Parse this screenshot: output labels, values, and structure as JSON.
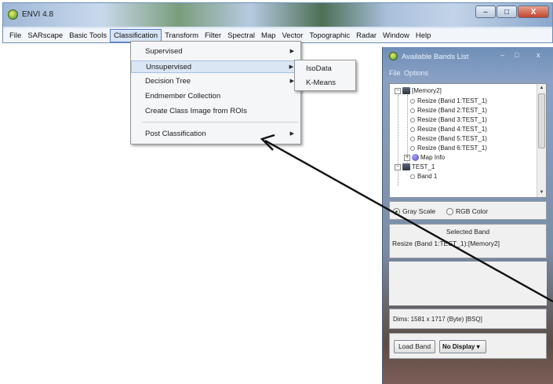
{
  "main_window": {
    "title": "ENVI 4.8",
    "controls": {
      "minimize": "–",
      "maximize": "□",
      "close": "X"
    },
    "menu": [
      "File",
      "SARscape",
      "Basic Tools",
      "Classification",
      "Transform",
      "Filter",
      "Spectral",
      "Map",
      "Vector",
      "Topographic",
      "Radar",
      "Window",
      "Help"
    ],
    "active_menu": "Classification"
  },
  "classification_menu": {
    "items": [
      "Supervised",
      "Unsupervised",
      "Decision Tree",
      "Endmember Collection",
      "Create Class Image from ROIs",
      "Post Classification"
    ],
    "has_submenu": [
      true,
      true,
      true,
      false,
      false,
      true
    ],
    "highlighted": "Unsupervised",
    "submenu_arrow": "▶"
  },
  "unsupervised_submenu": {
    "items": [
      "IsoData",
      "K-Means"
    ]
  },
  "bands_window": {
    "title": "Available Bands List",
    "controls": {
      "minimize": "–",
      "maximize": "□",
      "close": "x"
    },
    "menu": "File  Options",
    "tree": {
      "root1": "[Memory2]",
      "bands": [
        "Resize (Band 1:TEST_1)",
        "Resize (Band 2:TEST_1)",
        "Resize (Band 3:TEST_1)",
        "Resize (Band 4:TEST_1)",
        "Resize (Band 5:TEST_1)",
        "Resize (Band 6:TEST_1)"
      ],
      "map_info": "Map Info",
      "root2": "TEST_1",
      "root2_child": "Band 1",
      "expand_symbol": "+",
      "collapse_symbol": "−"
    },
    "scroll": {
      "up": "▲",
      "down": "▼"
    },
    "color_mode": {
      "gray_label": "Gray Scale",
      "rgb_label": "RGB Color",
      "selected": "Gray Scale"
    },
    "selected_band_header": "Selected Band",
    "selected_band_value": "Resize (Band 1:TEST_1):[Memory2]",
    "dims": "Dims: 1581 x 1717 (Byte) [BSQ]",
    "load_band_label": "Load Band",
    "display_label": "No Display",
    "display_caret": "▾"
  },
  "colors": {
    "menu_highlight": "#dbe6f4",
    "active_menu_border": "#5a7ec0",
    "arrow": "#111111"
  }
}
